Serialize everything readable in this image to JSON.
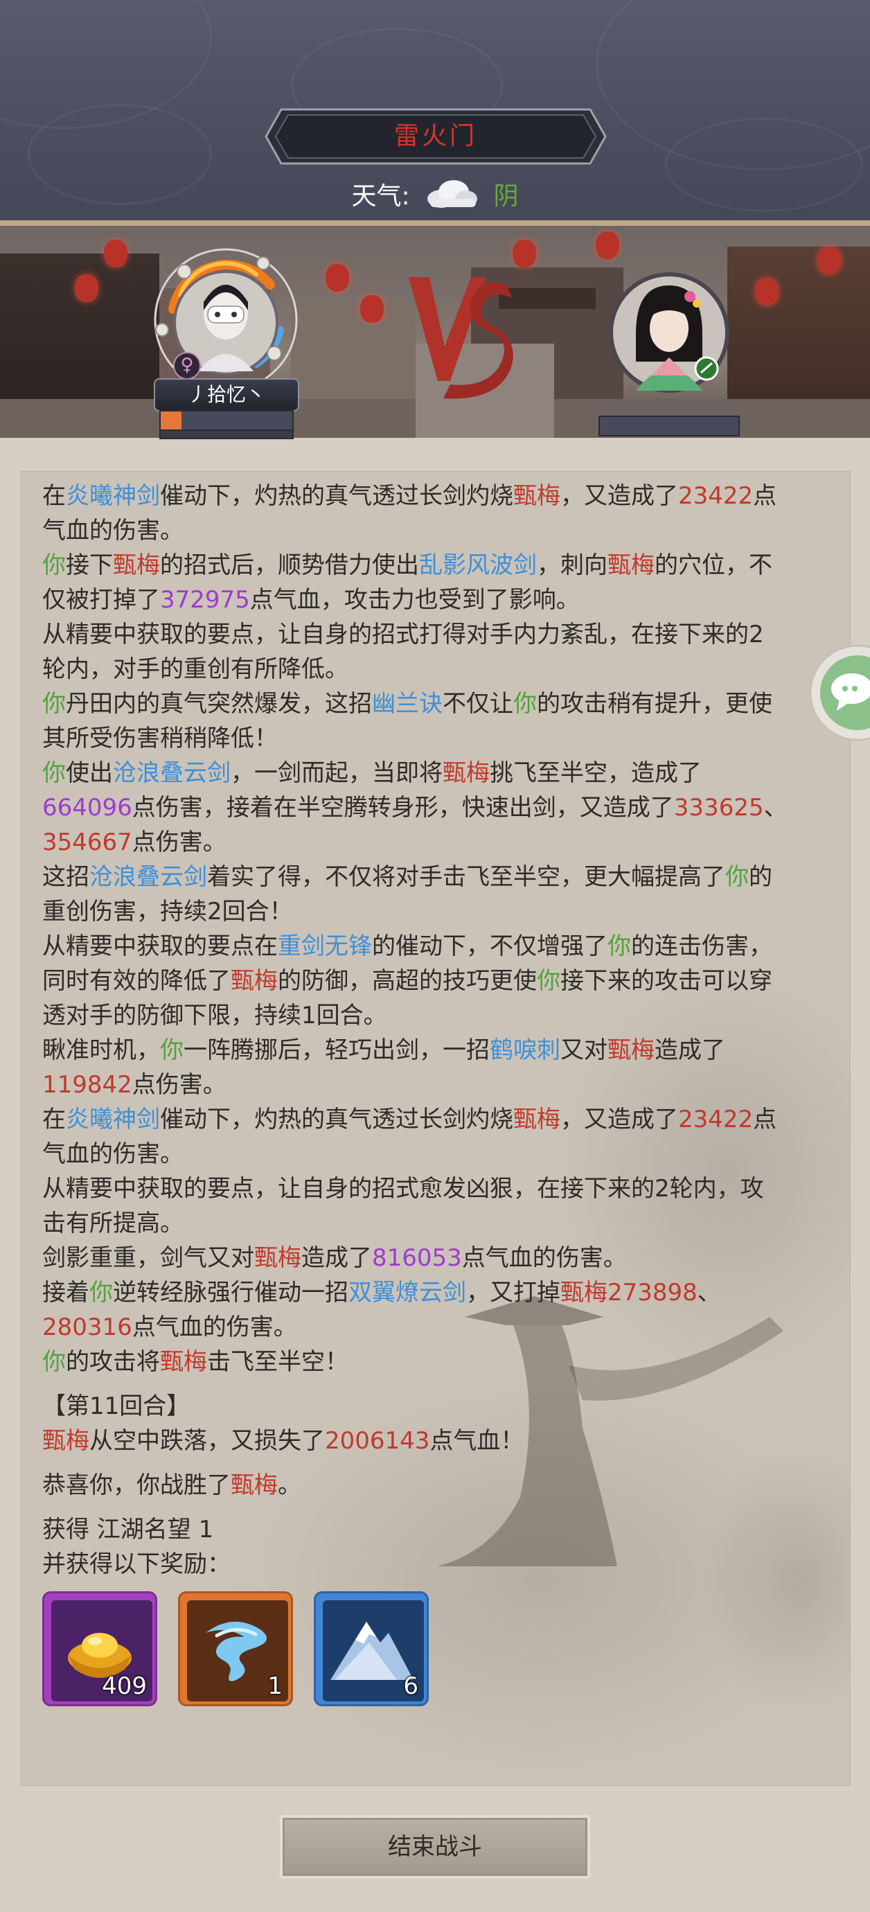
{
  "header": {
    "sect_name": "雷火门",
    "weather_label": "天气:",
    "weather_value": "阴",
    "weather_icon": "cloud-icon"
  },
  "battle": {
    "player_name": "丿拾忆丶",
    "player_gender_icon": "female-icon",
    "player_hp_fraction": 0.16,
    "enemy_hp_fraction": 0,
    "vs_label": "VS"
  },
  "log": {
    "lines": [
      [
        {
          "t": "在"
        },
        {
          "t": "炎曦神剑",
          "c": "skill"
        },
        {
          "t": "催动下，灼热的真气透过长剑灼烧"
        },
        {
          "t": "甄梅",
          "c": "enemy"
        },
        {
          "t": "，又造成了"
        },
        {
          "t": "23422",
          "c": "red"
        },
        {
          "t": "点"
        }
      ],
      [
        {
          "t": "气血的伤害。"
        }
      ],
      [
        {
          "t": "你",
          "c": "you"
        },
        {
          "t": "接下"
        },
        {
          "t": "甄梅",
          "c": "enemy"
        },
        {
          "t": "的招式后，顺势借力使出"
        },
        {
          "t": "乱影风波剑",
          "c": "skill"
        },
        {
          "t": "，刺向"
        },
        {
          "t": "甄梅",
          "c": "enemy"
        },
        {
          "t": "的穴位，不"
        }
      ],
      [
        {
          "t": "仅被打掉了"
        },
        {
          "t": "372975",
          "c": "purple"
        },
        {
          "t": "点气血，攻击力也受到了影响。"
        }
      ],
      [
        {
          "t": "从精要中获取的要点，让自身的招式打得对手内力紊乱，在接下来的2"
        }
      ],
      [
        {
          "t": "轮内，对手的重创有所降低。"
        }
      ],
      [
        {
          "t": "你",
          "c": "you"
        },
        {
          "t": "丹田内的真气突然爆发，这招"
        },
        {
          "t": "幽兰诀",
          "c": "skill"
        },
        {
          "t": "不仅让"
        },
        {
          "t": "你",
          "c": "you"
        },
        {
          "t": "的攻击稍有提升，更使"
        }
      ],
      [
        {
          "t": "其所受伤害稍稍降低！"
        }
      ],
      [
        {
          "t": "你",
          "c": "you"
        },
        {
          "t": "使出"
        },
        {
          "t": "沧浪叠云剑",
          "c": "skill"
        },
        {
          "t": "，一剑而起，当即将"
        },
        {
          "t": "甄梅",
          "c": "enemy"
        },
        {
          "t": "挑飞至半空，造成了"
        }
      ],
      [
        {
          "t": "664096",
          "c": "purple"
        },
        {
          "t": "点伤害，接着在半空腾转身形，快速出剑，又造成了"
        },
        {
          "t": "333625",
          "c": "red"
        },
        {
          "t": "、"
        }
      ],
      [
        {
          "t": "354667",
          "c": "red"
        },
        {
          "t": "点伤害。"
        }
      ],
      [
        {
          "t": "这招"
        },
        {
          "t": "沧浪叠云剑",
          "c": "skill"
        },
        {
          "t": "着实了得，不仅将对手击飞至半空，更大幅提高了"
        },
        {
          "t": "你",
          "c": "you"
        },
        {
          "t": "的"
        }
      ],
      [
        {
          "t": "重创伤害，持续2回合！"
        }
      ],
      [
        {
          "t": "从精要中获取的要点在"
        },
        {
          "t": "重剑无锋",
          "c": "skill"
        },
        {
          "t": "的催动下，不仅增强了"
        },
        {
          "t": "你",
          "c": "you"
        },
        {
          "t": "的连击伤害，"
        }
      ],
      [
        {
          "t": "同时有效的降低了"
        },
        {
          "t": "甄梅",
          "c": "enemy"
        },
        {
          "t": "的防御，高超的技巧更使"
        },
        {
          "t": "你",
          "c": "you"
        },
        {
          "t": "接下来的攻击可以穿"
        }
      ],
      [
        {
          "t": "透对手的防御下限，持续1回合。"
        }
      ],
      [
        {
          "t": "瞅准时机，"
        },
        {
          "t": "你",
          "c": "you"
        },
        {
          "t": "一阵腾挪后，轻巧出剑，一招"
        },
        {
          "t": "鹤唳刺",
          "c": "skill"
        },
        {
          "t": "又对"
        },
        {
          "t": "甄梅",
          "c": "enemy"
        },
        {
          "t": "造成了"
        }
      ],
      [
        {
          "t": "119842",
          "c": "red"
        },
        {
          "t": "点伤害。"
        }
      ],
      [
        {
          "t": "在"
        },
        {
          "t": "炎曦神剑",
          "c": "skill"
        },
        {
          "t": "催动下，灼热的真气透过长剑灼烧"
        },
        {
          "t": "甄梅",
          "c": "enemy"
        },
        {
          "t": "，又造成了"
        },
        {
          "t": "23422",
          "c": "red"
        },
        {
          "t": "点"
        }
      ],
      [
        {
          "t": "气血的伤害。"
        }
      ],
      [
        {
          "t": "从精要中获取的要点，让自身的招式愈发凶狠，在接下来的2轮内，攻"
        }
      ],
      [
        {
          "t": "击有所提高。"
        }
      ],
      [
        {
          "t": "剑影重重，剑气又对"
        },
        {
          "t": "甄梅",
          "c": "enemy"
        },
        {
          "t": "造成了"
        },
        {
          "t": "816053",
          "c": "purple"
        },
        {
          "t": "点气血的伤害。"
        }
      ],
      [
        {
          "t": "接着"
        },
        {
          "t": "你",
          "c": "you"
        },
        {
          "t": "逆转经脉强行催动一招"
        },
        {
          "t": "双翼燎云剑",
          "c": "skill"
        },
        {
          "t": "，又打掉"
        },
        {
          "t": "甄梅",
          "c": "enemy"
        },
        {
          "t": "273898",
          "c": "red"
        },
        {
          "t": "、"
        }
      ],
      [
        {
          "t": "280316",
          "c": "red"
        },
        {
          "t": "点气血的伤害。"
        }
      ],
      [
        {
          "t": "你",
          "c": "you"
        },
        {
          "t": "的攻击将"
        },
        {
          "t": "甄梅",
          "c": "enemy"
        },
        {
          "t": "击飞至半空！"
        }
      ],
      "gap",
      [
        {
          "t": "【第11回合】"
        }
      ],
      [
        {
          "t": "甄梅",
          "c": "enemy"
        },
        {
          "t": "从空中跌落，又损失了"
        },
        {
          "t": "2006143",
          "c": "red"
        },
        {
          "t": "点气血！"
        }
      ],
      "gap",
      [
        {
          "t": "恭喜你，你战胜了"
        },
        {
          "t": "甄梅",
          "c": "enemy"
        },
        {
          "t": "。"
        }
      ],
      "gap",
      [
        {
          "t": "获得 江湖名望 1"
        }
      ],
      [
        {
          "t": "并获得以下奖励："
        }
      ]
    ]
  },
  "rewards": [
    {
      "name": "gold-ingot-icon",
      "quantity": "409",
      "frame_color": "#a43fc2",
      "bg_color": "#4b2266"
    },
    {
      "name": "blue-wisp-icon",
      "quantity": "1",
      "frame_color": "#e0762f",
      "bg_color": "#5a2f16"
    },
    {
      "name": "snow-mountain-icon",
      "quantity": "6",
      "frame_color": "#3f86d8",
      "bg_color": "#1d3e6b"
    }
  ],
  "side_chat": {
    "icon": "chat-bubble-icon"
  },
  "footer": {
    "end_battle_label": "结束战斗"
  },
  "colors": {
    "skill": "#3f8fd8",
    "enemy": "#c2392b",
    "you": "#52a23c",
    "damage_red": "#c2392b",
    "damage_purple": "#a03ad0",
    "title": "#d7352a"
  }
}
